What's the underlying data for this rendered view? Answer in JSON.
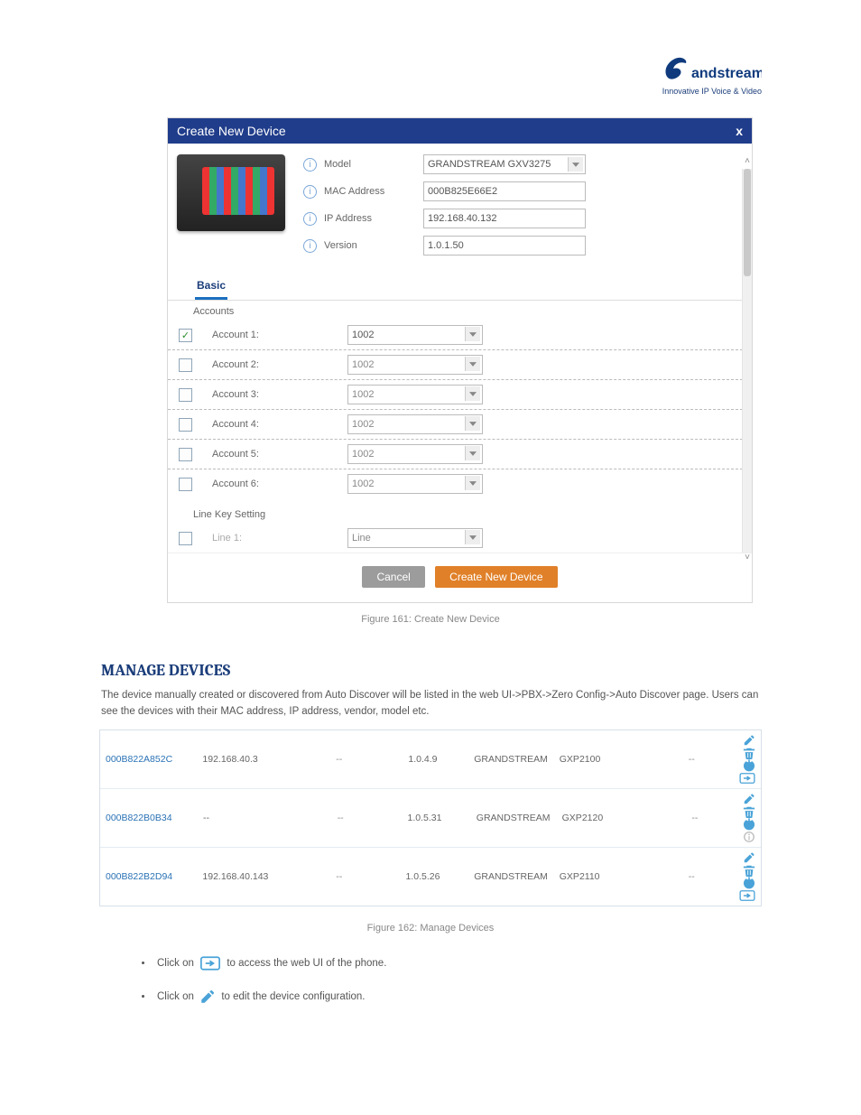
{
  "logo": {
    "brand": "Grandstream",
    "subtitle": "Innovative IP Voice & Video"
  },
  "dialog": {
    "title": "Create New Device",
    "close": "x",
    "model_label": "Model",
    "model_value": "GRANDSTREAM GXV3275",
    "mac_label": "MAC Address",
    "mac_value": "000B825E66E2",
    "ip_label": "IP Address",
    "ip_value": "192.168.40.132",
    "ver_label": "Version",
    "ver_value": "1.0.1.50",
    "tab_basic": "Basic",
    "sec_accounts": "Accounts",
    "accounts": [
      {
        "label": "Account 1:",
        "value": "1002",
        "enabled": true
      },
      {
        "label": "Account 2:",
        "value": "1002",
        "enabled": false
      },
      {
        "label": "Account 3:",
        "value": "1002",
        "enabled": false
      },
      {
        "label": "Account 4:",
        "value": "1002",
        "enabled": false
      },
      {
        "label": "Account 5:",
        "value": "1002",
        "enabled": false
      },
      {
        "label": "Account 6:",
        "value": "1002",
        "enabled": false
      }
    ],
    "sec_line": "Line Key Setting",
    "line1_label": "Line 1:",
    "line1_value": "Line",
    "btn_cancel": "Cancel",
    "btn_create": "Create New Device"
  },
  "figure_caption": "Figure 161: Create New Device",
  "heading": "MANAGE DEVICES",
  "para1": "The device manually created or discovered from Auto Discover will be listed in the web UI->PBX->Zero Config->Auto Discover page. Users can see the devices with their MAC address, IP address, vendor, model etc.",
  "devices": [
    {
      "mac": "000B822A852C",
      "ip": "192.168.40.3",
      "ext": "--",
      "ver": "1.0.4.9",
      "vendor": "GRANDSTREAM",
      "model": "GXP2100",
      "cfg": "--",
      "ops": "full"
    },
    {
      "mac": "000B822B0B34",
      "ip": "--",
      "ext": "--",
      "ver": "1.0.5.31",
      "vendor": "GRANDSTREAM",
      "model": "GXP2120",
      "cfg": "--",
      "ops": "noweb"
    },
    {
      "mac": "000B822B2D94",
      "ip": "192.168.40.143",
      "ext": "--",
      "ver": "1.0.5.26",
      "vendor": "GRANDSTREAM",
      "model": "GXP2110",
      "cfg": "--",
      "ops": "full"
    }
  ],
  "table_caption": "Figure 162: Manage Devices",
  "bullets": {
    "b1a": "Click on ",
    "b1b": " to access the web UI of the phone.",
    "b2a": "Click on ",
    "b2b": " to edit the device configuration."
  }
}
